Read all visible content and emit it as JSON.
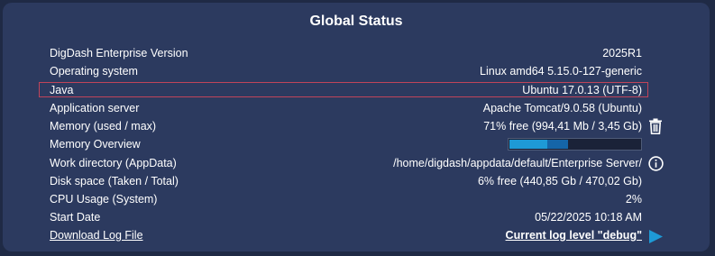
{
  "title": "Global Status",
  "rows": [
    {
      "label": "DigDash Enterprise Version",
      "value": "2025R1"
    },
    {
      "label": "Operating system",
      "value": "Linux amd64 5.15.0-127-generic"
    },
    {
      "label": "Java",
      "value": "Ubuntu 17.0.13 (UTF-8)"
    },
    {
      "label": "Application server",
      "value": "Apache Tomcat/9.0.58 (Ubuntu)"
    },
    {
      "label": "Memory (used / max)",
      "value": "71% free (994,41 Mb / 3,45 Gb)"
    },
    {
      "label": "Memory Overview",
      "value": ""
    },
    {
      "label": "Work directory (AppData)",
      "value": "/home/digdash/appdata/default/Enterprise Server/"
    },
    {
      "label": "Disk space (Taken / Total)",
      "value": "6% free (440,85 Gb / 470,02 Gb)"
    },
    {
      "label": "CPU Usage (System)",
      "value": "2%"
    },
    {
      "label": "Start Date",
      "value": "05/22/2025 10:18 AM"
    },
    {
      "label": "Download Log File",
      "value": "Current log level \"debug\""
    }
  ],
  "memory_overview": {
    "used_fraction_primary": 0.29,
    "used_fraction_secondary": 0.16
  },
  "colors": {
    "background": "#1f2a45",
    "panel": "#2c3a5f",
    "highlight_border": "#c0445a",
    "accent": "#1e9ad6"
  },
  "icons": {
    "trash": "trash-icon",
    "info": "info-icon",
    "play": "play-icon"
  }
}
